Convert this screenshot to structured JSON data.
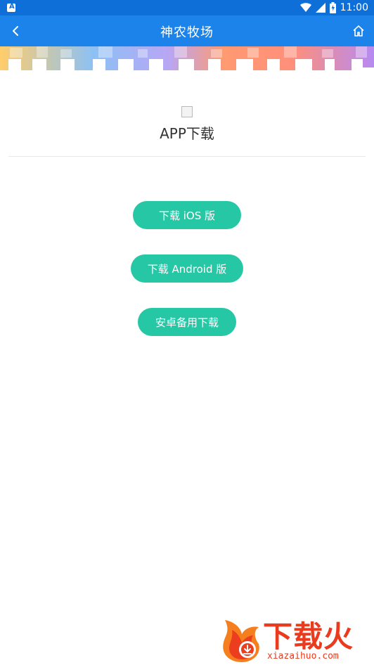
{
  "status_bar": {
    "time": "11:00",
    "icons": [
      "notification-icon",
      "wifi-icon",
      "cell-signal-icon",
      "battery-icon"
    ]
  },
  "app_bar": {
    "title": "神农牧场",
    "back_icon": "chevron-left-icon",
    "home_icon": "home-icon"
  },
  "main": {
    "brand_title": "APP下载",
    "buttons": {
      "ios": "下载 iOS 版",
      "android": "下载 Android 版",
      "backup": "安卓备用下载"
    }
  },
  "watermark": {
    "brand": "下载火",
    "domain": "xiazaihuo.com"
  },
  "colors": {
    "status_bar": "#0f6fd8",
    "app_bar": "#1b83ea",
    "button": "#26c7a5"
  }
}
